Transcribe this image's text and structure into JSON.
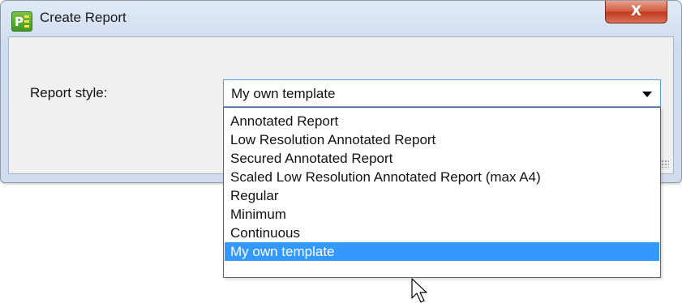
{
  "window": {
    "title": "Create Report",
    "app_icon": "pdf-app-icon",
    "close_glyph": "X"
  },
  "form": {
    "report_style_label": "Report style:",
    "report_style_value": "My own template"
  },
  "dropdown": {
    "options": [
      "Annotated Report",
      "Low Resolution Annotated Report",
      "Secured Annotated Report",
      "Scaled Low Resolution Annotated Report (max A4)",
      "Regular",
      "Minimum",
      "Continuous",
      "My own template"
    ],
    "selected_index": 7
  },
  "colors": {
    "selection": "#3399ff",
    "close_button": "#c0391c"
  },
  "icons": [
    "pdf-app-icon",
    "close-icon",
    "dropdown-arrow-icon",
    "resize-grip-icon",
    "mouse-cursor-icon"
  ]
}
